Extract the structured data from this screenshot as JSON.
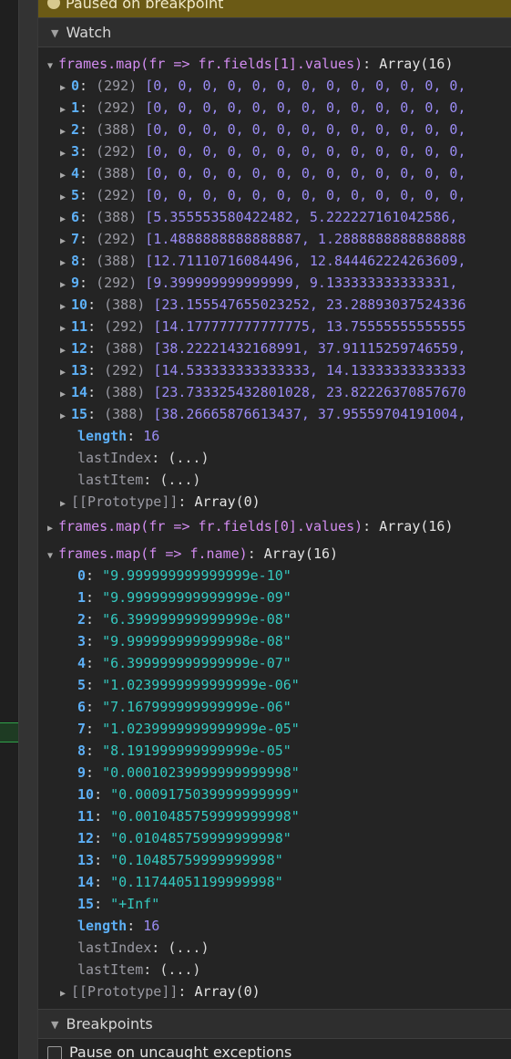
{
  "paused_banner": "Paused on breakpoint",
  "watch_header": "Watch",
  "breakpoints_header": "Breakpoints",
  "pause_uncaught": "Pause on uncaught exceptions",
  "watch1": {
    "expression": "frames.map(fr => fr.fields[1].values)",
    "summary": "Array(16)",
    "items": [
      {
        "key": "0",
        "count": "(292)",
        "preview": "[0, 0, 0, 0, 0, 0, 0, 0, 0, 0, 0, 0, 0,"
      },
      {
        "key": "1",
        "count": "(292)",
        "preview": "[0, 0, 0, 0, 0, 0, 0, 0, 0, 0, 0, 0, 0,"
      },
      {
        "key": "2",
        "count": "(388)",
        "preview": "[0, 0, 0, 0, 0, 0, 0, 0, 0, 0, 0, 0, 0,"
      },
      {
        "key": "3",
        "count": "(292)",
        "preview": "[0, 0, 0, 0, 0, 0, 0, 0, 0, 0, 0, 0, 0,"
      },
      {
        "key": "4",
        "count": "(388)",
        "preview": "[0, 0, 0, 0, 0, 0, 0, 0, 0, 0, 0, 0, 0,"
      },
      {
        "key": "5",
        "count": "(292)",
        "preview": "[0, 0, 0, 0, 0, 0, 0, 0, 0, 0, 0, 0, 0,"
      },
      {
        "key": "6",
        "count": "(388)",
        "preview": "[5.355553580422482, 5.222227161042586,"
      },
      {
        "key": "7",
        "count": "(292)",
        "preview": "[1.4888888888888887, 1.2888888888888888"
      },
      {
        "key": "8",
        "count": "(388)",
        "preview": "[12.71110716084496, 12.844462224263609,"
      },
      {
        "key": "9",
        "count": "(292)",
        "preview": "[9.399999999999999, 9.133333333333331,"
      },
      {
        "key": "10",
        "count": "(388)",
        "preview": "[23.155547655023252, 23.28893037524336"
      },
      {
        "key": "11",
        "count": "(292)",
        "preview": "[14.177777777777775, 13.75555555555555"
      },
      {
        "key": "12",
        "count": "(388)",
        "preview": "[38.22221432168991, 37.91115259746559,"
      },
      {
        "key": "13",
        "count": "(292)",
        "preview": "[14.533333333333333, 14.13333333333333"
      },
      {
        "key": "14",
        "count": "(388)",
        "preview": "[23.733325432801028, 23.82226370857670"
      },
      {
        "key": "15",
        "count": "(388)",
        "preview": "[38.26665876613437, 37.95559704191004,"
      }
    ],
    "length_label": "length",
    "length_value": "16",
    "last_index_label": "lastIndex",
    "last_item_label": "lastItem",
    "lazy_value": "(...)",
    "prototype_label": "[[Prototype]]",
    "prototype_value": "Array(0)"
  },
  "watch2": {
    "expression": "frames.map(fr => fr.fields[0].values)",
    "summary": "Array(16)"
  },
  "watch3": {
    "expression": "frames.map(f => f.name)",
    "summary": "Array(16)",
    "items": [
      {
        "key": "0",
        "value": "\"9.999999999999999e-10\""
      },
      {
        "key": "1",
        "value": "\"9.999999999999999e-09\""
      },
      {
        "key": "2",
        "value": "\"6.399999999999999e-08\""
      },
      {
        "key": "3",
        "value": "\"9.999999999999998e-08\""
      },
      {
        "key": "4",
        "value": "\"6.399999999999999e-07\""
      },
      {
        "key": "5",
        "value": "\"1.0239999999999999e-06\""
      },
      {
        "key": "6",
        "value": "\"7.167999999999999e-06\""
      },
      {
        "key": "7",
        "value": "\"1.0239999999999999e-05\""
      },
      {
        "key": "8",
        "value": "\"8.191999999999999e-05\""
      },
      {
        "key": "9",
        "value": "\"0.00010239999999999998\""
      },
      {
        "key": "10",
        "value": "\"0.0009175039999999999\""
      },
      {
        "key": "11",
        "value": "\"0.0010485759999999998\""
      },
      {
        "key": "12",
        "value": "\"0.010485759999999998\""
      },
      {
        "key": "13",
        "value": "\"0.10485759999999998\""
      },
      {
        "key": "14",
        "value": "\"0.11744051199999998\""
      },
      {
        "key": "15",
        "value": "\"+Inf\""
      }
    ],
    "length_label": "length",
    "length_value": "16",
    "last_index_label": "lastIndex",
    "last_item_label": "lastItem",
    "lazy_value": "(...)",
    "prototype_label": "[[Prototype]]",
    "prototype_value": "Array(0)"
  },
  "colors": {
    "background": "#242424",
    "banner": "#6b5a15",
    "expression": "#d28cf0",
    "key": "#5db0f7",
    "number": "#9b8cf5",
    "string": "#34c9c0"
  }
}
